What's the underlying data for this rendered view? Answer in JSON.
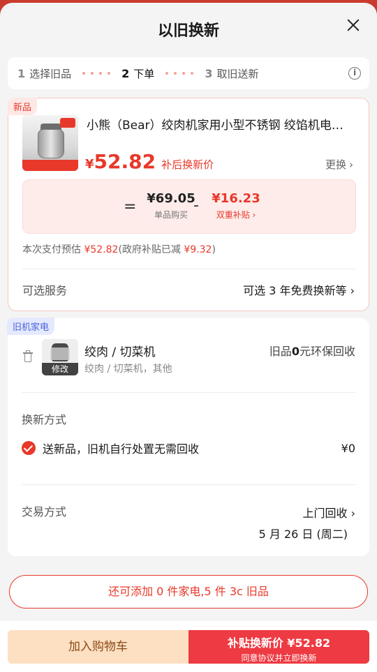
{
  "header": {
    "title": "以旧换新"
  },
  "steps": [
    {
      "num": "1",
      "label": "选择旧品"
    },
    {
      "num": "2",
      "label": "下单"
    },
    {
      "num": "3",
      "label": "取旧送新"
    }
  ],
  "new_item": {
    "tag": "新品",
    "name": "小熊（Bear）绞肉机家用小型不锈钢 绞馅机电…",
    "price_symbol": "¥",
    "price": "52.82",
    "price_note": "补后换新价",
    "swap_label": "更换",
    "calc": {
      "equals": "=",
      "unit_price": "¥69.05",
      "unit_label": "单品购买",
      "minus": "-",
      "subsidy": "¥16.23",
      "subsidy_label": "双重补贴 ›"
    },
    "estimate_prefix": "本次支付预估 ",
    "estimate_amount": "¥52.82",
    "estimate_mid": "(政府补贴已减 ",
    "estimate_reduced": "¥9.32",
    "estimate_suffix": ")",
    "service_label": "可选服务",
    "service_value": "可选 3 年免费换新等 ›"
  },
  "old_item": {
    "tag": "旧机家电",
    "edit_label": "修改",
    "name": "绞肉 / 切菜机",
    "sub": "绞肉 / 切菜机，其他",
    "recycle_prefix": "旧品",
    "recycle_bold": "0",
    "recycle_suffix": "元环保回收",
    "method_title": "换新方式",
    "method_option": "送新品，旧机自行处置无需回收",
    "method_price": "¥0",
    "trade_title": "交易方式",
    "trade_value": "上门回收 ›",
    "trade_date": "5 月 26 日 (周二)"
  },
  "add_more": "还可添加 0 件家电,5 件 3c 旧品",
  "footer": {
    "cart_label": "加入购物车",
    "buy_label": "补贴换新价  ¥52.82",
    "buy_sub": "同意协议并立即换新"
  }
}
